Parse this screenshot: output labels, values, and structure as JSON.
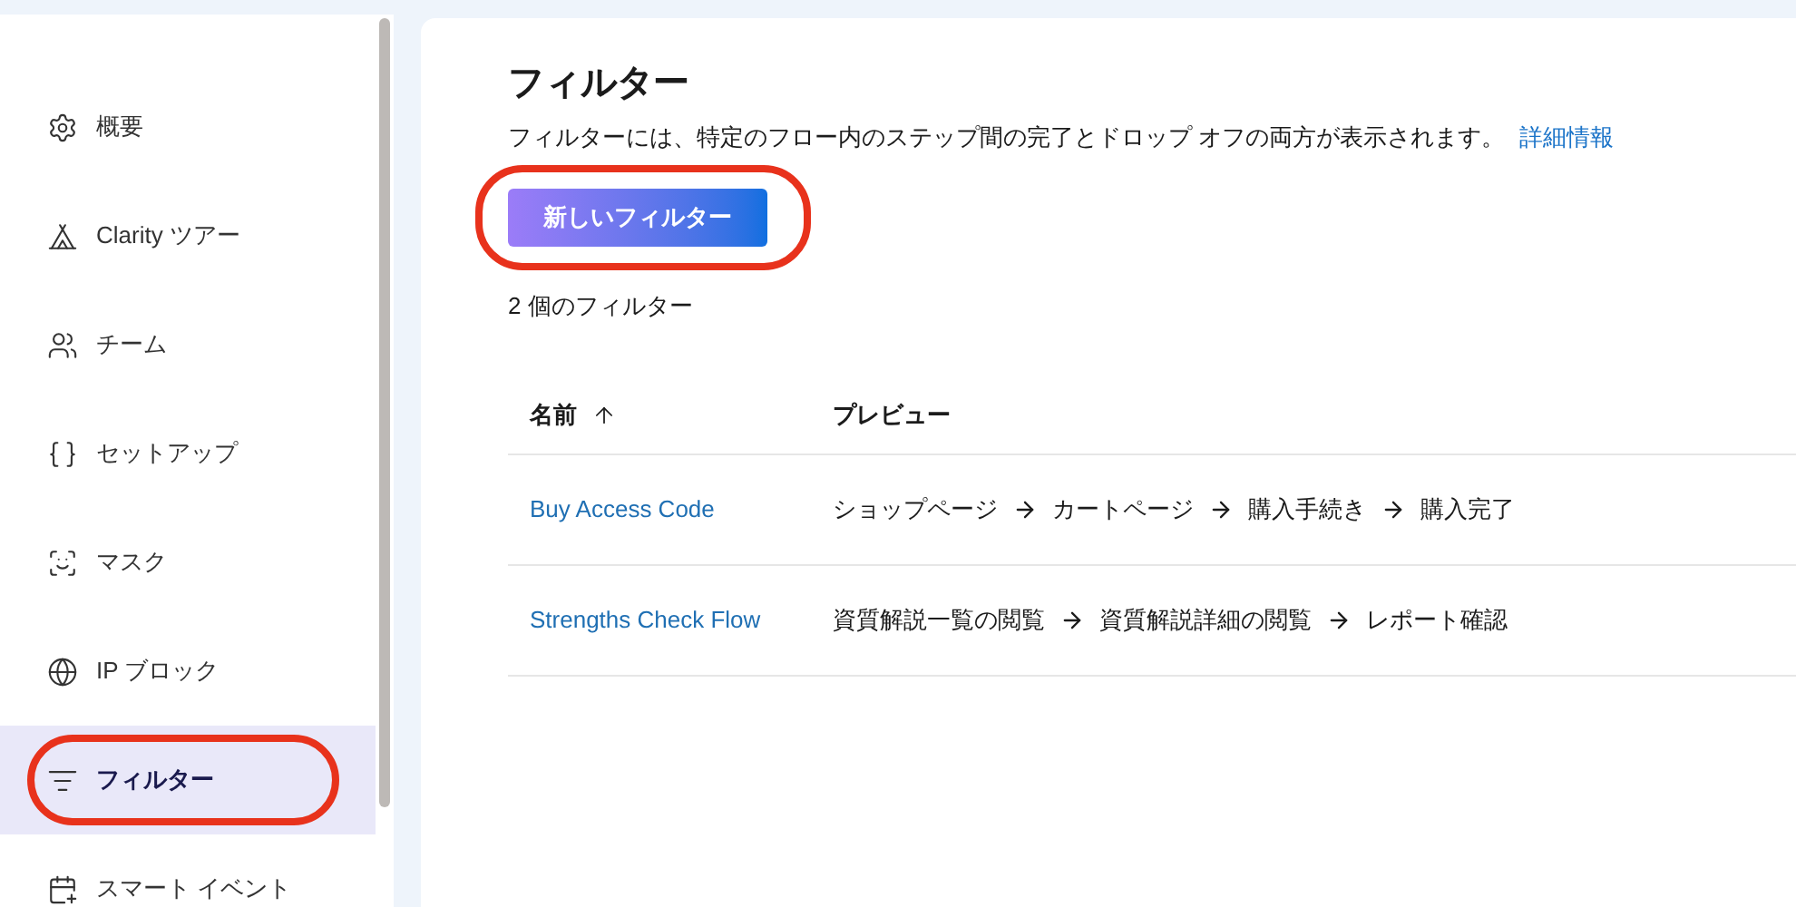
{
  "sidebar": {
    "items": [
      {
        "label": "概要",
        "kind": "gear",
        "selected": false
      },
      {
        "label": "Clarity ツアー",
        "kind": "tour",
        "selected": false
      },
      {
        "label": "チーム",
        "kind": "team",
        "selected": false
      },
      {
        "label": "セットアップ",
        "kind": "braces",
        "selected": false
      },
      {
        "label": "マスク",
        "kind": "mask",
        "selected": false
      },
      {
        "label": "IP ブロック",
        "kind": "globe",
        "selected": false
      },
      {
        "label": "フィルター",
        "kind": "filter",
        "selected": true,
        "highlighted": true
      },
      {
        "label": "スマート イベント",
        "kind": "event",
        "selected": false
      }
    ]
  },
  "page": {
    "title": "フィルター",
    "description": "フィルターには、特定のフロー内のステップ間の完了とドロップ オフの両方が表示されます。",
    "learn_more": "詳細情報",
    "new_button": {
      "label": "新しいフィルター",
      "highlighted": true
    },
    "count": "2 個のフィルター"
  },
  "table": {
    "columns": [
      {
        "label": "名前",
        "sorted": true
      },
      {
        "label": "プレビュー",
        "sorted": false
      }
    ],
    "rows": [
      {
        "name": "Buy Access Code",
        "steps": [
          "ショップページ",
          "カートページ",
          "購入手続き",
          "購入完了"
        ]
      },
      {
        "name": "Strengths Check Flow",
        "steps": [
          "資質解説一覧の閲覧",
          "資質解説詳細の閲覧",
          "レポート確認"
        ]
      }
    ]
  }
}
